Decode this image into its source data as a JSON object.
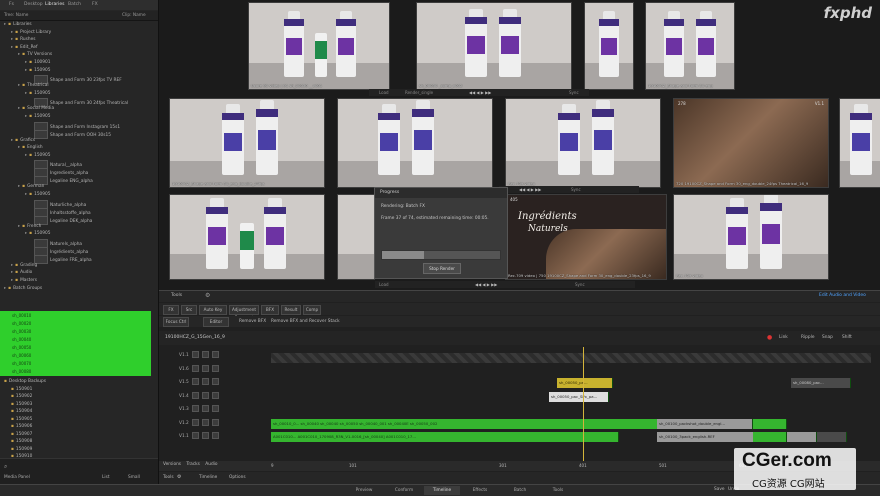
{
  "left_panel": {
    "tabs": [
      "Fs",
      "Desktop",
      "Libraries",
      "Batch",
      "FX"
    ],
    "filter_label": "Tree: Name",
    "filter_right": "Clip: Name",
    "tree": [
      {
        "label": "Libraries",
        "level": 0
      },
      {
        "label": "Project Library",
        "level": 1
      },
      {
        "label": "Rushes",
        "level": 1
      },
      {
        "label": "Edit_Ref",
        "level": 1
      },
      {
        "label": "TV Versions",
        "level": 2
      },
      {
        "label": "100901",
        "level": 3
      },
      {
        "label": "150905",
        "level": 3
      },
      {
        "label": "Shape and Form 30 23fps TV REF",
        "level": 4
      },
      {
        "label": "Theatrical",
        "level": 2
      },
      {
        "label": "150905",
        "level": 3
      },
      {
        "label": "Shape and Form 30 24fps Theatrical",
        "level": 4
      },
      {
        "label": "Social Media",
        "level": 2
      },
      {
        "label": "150905",
        "level": 3
      },
      {
        "label": "Shape and Form Instagram 15s1",
        "level": 4
      },
      {
        "label": "Shape and Form OOH 30s15",
        "level": 4
      },
      {
        "label": "Grafics",
        "level": 1
      },
      {
        "label": "English",
        "level": 2
      },
      {
        "label": "150905",
        "level": 3
      },
      {
        "label": "Natural__alpha",
        "level": 4
      },
      {
        "label": "Ingredients_alpha",
        "level": 4
      },
      {
        "label": "Legaline ENG_alpha",
        "level": 4
      },
      {
        "label": "German",
        "level": 2
      },
      {
        "label": "150905",
        "level": 3
      },
      {
        "label": "Naturliche_alpha",
        "level": 4
      },
      {
        "label": "Inhaltsstoffe_alpha",
        "level": 4
      },
      {
        "label": "Legaline DEK_alpha",
        "level": 4
      },
      {
        "label": "French",
        "level": 2
      },
      {
        "label": "150905",
        "level": 3
      },
      {
        "label": "Naturels_alpha",
        "level": 4
      },
      {
        "label": "Ingrédients_alpha",
        "level": 4
      },
      {
        "label": "Legaline FRE_alpha",
        "level": 4
      },
      {
        "label": "Grading",
        "level": 1
      },
      {
        "label": "Audio",
        "level": 1
      },
      {
        "label": "Masters",
        "level": 1
      },
      {
        "label": "Batch Groups",
        "level": 0
      }
    ],
    "batch_groups": [
      "sh_00010",
      "sh_00020",
      "sh_00030",
      "sh_00040",
      "sh_00050",
      "sh_00060",
      "sh_00070",
      "sh_00080"
    ],
    "desktop_tree": [
      {
        "label": "Desktop Backups",
        "level": 0
      },
      {
        "label": "150901",
        "level": 1
      },
      {
        "label": "150902",
        "level": 1
      },
      {
        "label": "150903",
        "level": 1
      },
      {
        "label": "150904",
        "level": 1
      },
      {
        "label": "150905",
        "level": 1
      },
      {
        "label": "150906",
        "level": 1
      },
      {
        "label": "150907",
        "level": 1
      },
      {
        "label": "150908",
        "level": 1
      },
      {
        "label": "150909",
        "level": 1
      },
      {
        "label": "150910",
        "level": 1
      }
    ],
    "bottom": {
      "media_panel": "Media Panel",
      "list": "List",
      "small": "Small"
    }
  },
  "viewers": {
    "row1": [
      {
        "label": "Ucore 90 video | 91 sh_00030 __v001",
        "type": "bottles_tube"
      },
      {
        "label": "sh_00030 _comp_v002",
        "type": "bottles"
      },
      {
        "label": "",
        "type": "bottles_single"
      },
      {
        "label": "19100CZ_Shape and Form 50 eng",
        "type": "bottles_small"
      }
    ],
    "row1_controls": {
      "left": "Load",
      "mid": "Render_single",
      "sync": "Sync"
    },
    "row2": [
      {
        "label": "19100CZ_Shape and Form 30_eng_double_24fps",
        "type": "bottles_blue"
      },
      {
        "label": "sh_00030_comp",
        "type": "bottles_blue"
      },
      {
        "label": "Rec.709 video",
        "type": "bottles_blue"
      },
      {
        "label": "720 19100CZ_Shape and Form 30_eng_double_24fps Theatrical_16_9",
        "type": "skin"
      },
      {
        "label": "",
        "type": "bottles_single"
      }
    ],
    "row2_top_right": "V1.1",
    "row2_ctrl": {
      "sync": "Sync",
      "tc": "278"
    },
    "row3": [
      {
        "label": "",
        "type": "bottles_tube"
      },
      {
        "label": "Rec.709 video | 750 19100CZ_Shape and Form 30_eng_double_23fps_16_9",
        "type": "ingredients"
      },
      {
        "label": "Rec.709 video",
        "type": "bottles_pair"
      }
    ],
    "ingredients_text": [
      "Ingrédients",
      "Naturels"
    ],
    "row3_tc": "405",
    "row3_ctrl": {
      "load": "Load",
      "sync": "Sync"
    }
  },
  "progress_dialog": {
    "title": "Progress",
    "line1": "Rendering: Batch FX",
    "line2": "Frame 37 of 74, estimated remaining time: 00:05.",
    "progress": 0.36,
    "button": "Stop Render"
  },
  "timeline": {
    "toolbar1": {
      "left": "Tools",
      "right": "Edit Audio and Video"
    },
    "toolbar2": [
      "FX",
      "Src",
      "Auto Key",
      "Adjustment Segment",
      "BFX",
      "Result",
      "Comp"
    ],
    "toolbar3": [
      "Focus Ctrl",
      "Editor",
      "Remove BFX",
      "Remove BFX and Recover Stack"
    ],
    "sequence_name": "19100HCZ_G_15Gen_16_9",
    "right_tools": [
      "Link",
      "Ripple",
      "Snap",
      "Shift"
    ],
    "tracks": [
      "V1.1",
      "V1.6",
      "V1.5",
      "V1.4",
      "V1.3",
      "V1.2",
      "V1.1"
    ],
    "segments": [
      {
        "track": 2,
        "text": "sh_00050_pa...",
        "color": "yellow"
      },
      {
        "track": 2,
        "text": "sh_00080_pac...",
        "color": "dark"
      },
      {
        "track": 3,
        "text": "sh_00050_pac_SPx_pa...",
        "color": "white"
      },
      {
        "track": 5,
        "text": "sh_00010_0... sh_00040 sh_00040 sh_00050 sh_00040_001 sh_00040E sh_00050_002",
        "color": "green"
      },
      {
        "track": 5,
        "text": "sh_00100_packshot_double_engl...",
        "color": "grey"
      },
      {
        "track": 6,
        "text": "A001C010... A001C010_170908_R3N_V1-0016_[sh_00040] A001C010_17...",
        "color": "green"
      },
      {
        "track": 6,
        "text": "sh_00100_3pack_english-REF",
        "color": "grey"
      }
    ],
    "ruler": [
      "9",
      "101",
      "301",
      "401",
      "501",
      "601"
    ],
    "bottom_left": [
      "Versions",
      "Tracks",
      "Audio"
    ],
    "footer_left": [
      "Tools",
      "Timeline",
      "Options"
    ],
    "save": "Save",
    "undo": "Undo"
  },
  "bottom_tabs": [
    "Preview",
    "Conform",
    "Timeline",
    "Effects",
    "Batch",
    "Tools"
  ],
  "active_bottom_tab": "Timeline",
  "watermark_top": "fxphd",
  "watermark": {
    "big": "CGer.com",
    "small": "CG资源 CG网站"
  },
  "colors": {
    "green_highlight": "#2fcf2c",
    "segment_green": "#35b52f",
    "playhead": "#d4b43a"
  }
}
